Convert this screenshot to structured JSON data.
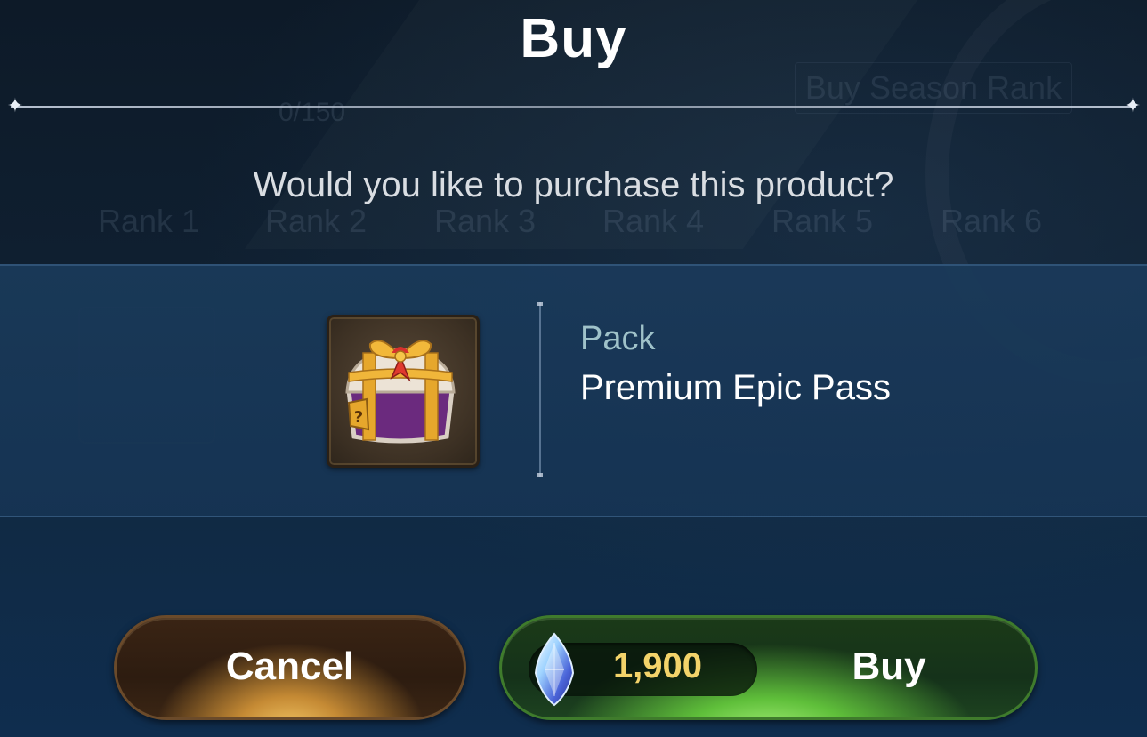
{
  "dialog": {
    "title": "Buy",
    "question": "Would you like to purchase this product?"
  },
  "product": {
    "category": "Pack",
    "name": "Premium Epic Pass",
    "icon": "gift-chest-icon"
  },
  "actions": {
    "cancel_label": "Cancel",
    "buy_label": "Buy",
    "price": "1,900",
    "currency_icon": "crystal-gem-icon"
  },
  "background": {
    "progress": "0/150",
    "buy_season_rank": "Buy Season Rank",
    "ranks": [
      "Rank 1",
      "Rank 2",
      "Rank 3",
      "Rank 4",
      "Rank 5",
      "Rank 6"
    ]
  }
}
